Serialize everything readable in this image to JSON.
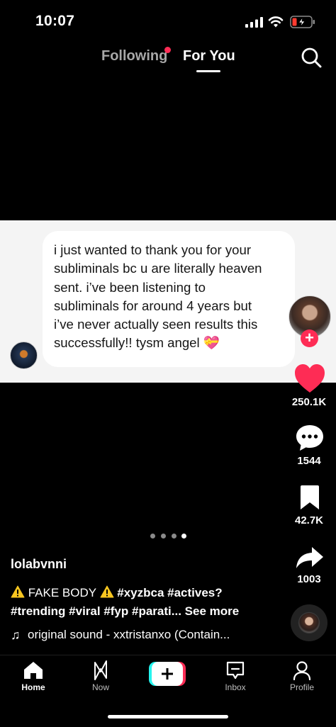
{
  "status_bar": {
    "time": "10:07"
  },
  "top_nav": {
    "following": "Following",
    "for_you": "For You"
  },
  "comment": {
    "lines": [
      "i just wanted to thank you for your",
      "subliminals bc u are literally heaven",
      "sent. i’ve been listening to",
      "subliminals for around 4 years but",
      "i’ve never actually seen results this",
      "successfully!! tysm angel 💝"
    ]
  },
  "rail": {
    "likes": "250.1K",
    "comments": "1544",
    "bookmarks": "42.7K",
    "shares": "1003"
  },
  "pagination": {
    "count": 4,
    "active": 4
  },
  "caption": {
    "username": "lolabvnni",
    "line1_text": "FAKE BODY",
    "line1_tags": "#xyzbca #actives?",
    "line2_tags": "#trending #viral #fyp #parati...",
    "see_more": "See more",
    "sound": "original sound - xxtristanxo (Contain..."
  },
  "bottom_nav": {
    "home": "Home",
    "now": "Now",
    "inbox": "Inbox",
    "profile": "Profile"
  },
  "colors": {
    "accent": "#fe2c55",
    "cyan": "#25f4ee",
    "background": "#000000"
  },
  "icons": [
    "signal-icon",
    "wifi-icon",
    "battery-charging-icon",
    "search-icon",
    "heart-icon",
    "comment-icon",
    "bookmark-icon",
    "share-icon",
    "music-note-icon",
    "warning-icon",
    "home-icon",
    "now-icon",
    "plus-icon",
    "inbox-icon",
    "profile-icon"
  ]
}
